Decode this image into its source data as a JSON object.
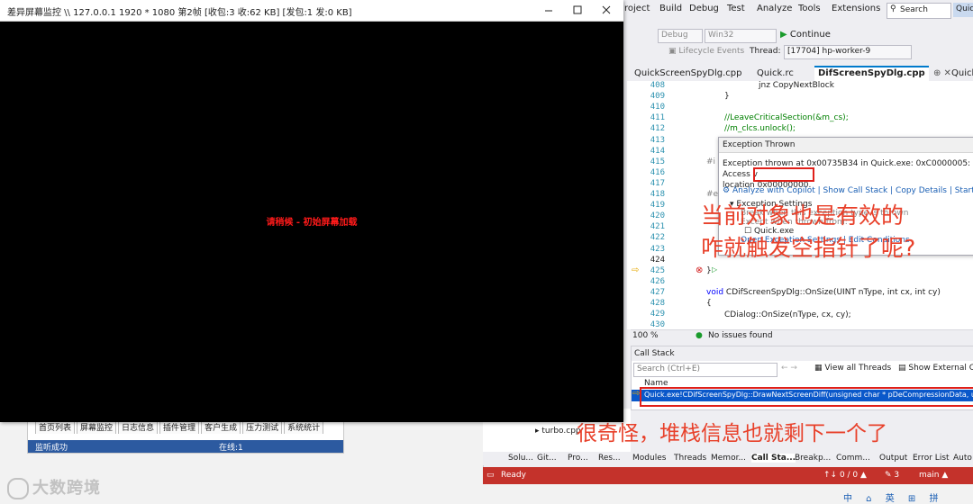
{
  "monitor": {
    "title": "差异屏幕监控 \\\\ 127.0.0.1 1920 * 1080 第2帧 [收包:3 收:62 KB] [发包:1 发:0 KB]",
    "message": "请稍候 - 初始屏幕加载"
  },
  "background_app": {
    "tabs": [
      "首页列表",
      "屏幕监控",
      "日志信息",
      "插件管理",
      "客户生成",
      "压力测试",
      "系统统计"
    ],
    "status_left": "监听成功",
    "status_right": "在线:1"
  },
  "watermark": "大数跨境",
  "vs": {
    "menu": [
      "roject",
      "Build",
      "Debug",
      "Test",
      "Analyze",
      "Tools",
      "Extensions"
    ],
    "search_label": "Search",
    "quick_button": "Quic",
    "toolbar": {
      "config": "Debug",
      "platform": "Win32",
      "continue": "Continue",
      "lifecycle": "Lifecycle Events",
      "thread_label": "Thread:",
      "thread_value": "[17704] hp-worker-9"
    },
    "doc_tabs": [
      "QuickScreenSpyDlg.cpp",
      "Quick.rc",
      "DifScreenSpyDlg.cpp",
      "QuickScre"
    ],
    "active_tab_index": 2,
    "line_numbers": [
      "408",
      "409",
      "410",
      "411",
      "412",
      "413",
      "414",
      "415",
      "416",
      "417",
      "418",
      "419",
      "420",
      "421",
      "422",
      "423",
      "424",
      "425",
      "426",
      "427",
      "428",
      "429",
      "430"
    ],
    "code": {
      "l408": "jnz CopyNextBlock",
      "l409": "}",
      "l411": "//LeaveCriticalSection(&m_cs);",
      "l412": "//m_clcs.unlock();",
      "l415": "#i",
      "l418": "#e",
      "l425": "}",
      "l427_kw": "void",
      "l427_rest": " CDifScreenSpyDlg::OnSize(UINT nType, int cx, int cy)",
      "l428": "{",
      "l429": "CDialog::OnSize(nType, cx, cy);"
    },
    "exception": {
      "title": "Exception Thrown",
      "message": "Exception thrown at 0x00735B34 in Quick.exe: 0xC0000005: Access v",
      "location_prefix": "location",
      "address": "0x00000000.",
      "links": [
        "Analyze with Copilot",
        "Show Call Stack",
        "Copy Details",
        "Start Live"
      ],
      "settings_title": "Exception Settings",
      "opt1": "Break when this exception type is thrown",
      "opt2": "Except when thrown from:",
      "opt3": "Quick.exe",
      "opt4": "Open Exception Settings",
      "opt5": "Edit Conditions"
    },
    "editor_status": {
      "zoom": "100 %",
      "issues": "No issues found"
    },
    "call_stack": {
      "title": "Call Stack",
      "search_placeholder": "Search (Ctrl+E)",
      "view_all": "View all Threads",
      "show_external": "Show External C",
      "col_name": "Name",
      "frame": "Quick.exe!CDifScreenSpyDlg::DrawNextScreenDiff(unsigned char * pDeCompressionData, unsign"
    },
    "tree_item": "turbo.cpp",
    "bottom_tabs": [
      "Solu...",
      "Git...",
      "Pro...",
      "Res...",
      "Modules",
      "Threads",
      "Memor...",
      "Call Sta...",
      "Breakp...",
      "Comm...",
      "Output",
      "Error List",
      "Auto"
    ],
    "status": {
      "ready": "Ready",
      "sync": "↑↓ 0 / 0 ▲",
      "edits": "✎ 3",
      "branch": "main ▲"
    }
  },
  "annotations": {
    "line1": "当前对象也是有效的",
    "line2": "咋就触发空指针了呢?",
    "line3": "很奇怪，堆栈信息也就剩下一个了"
  },
  "taskbar_text": "中 ⌂ 英 ⊞ 拼",
  "colors": {
    "accent": "#007acc",
    "status_bar": "#c4322b",
    "annotation": "#e8402a",
    "highlight_box": "#e0201a"
  }
}
